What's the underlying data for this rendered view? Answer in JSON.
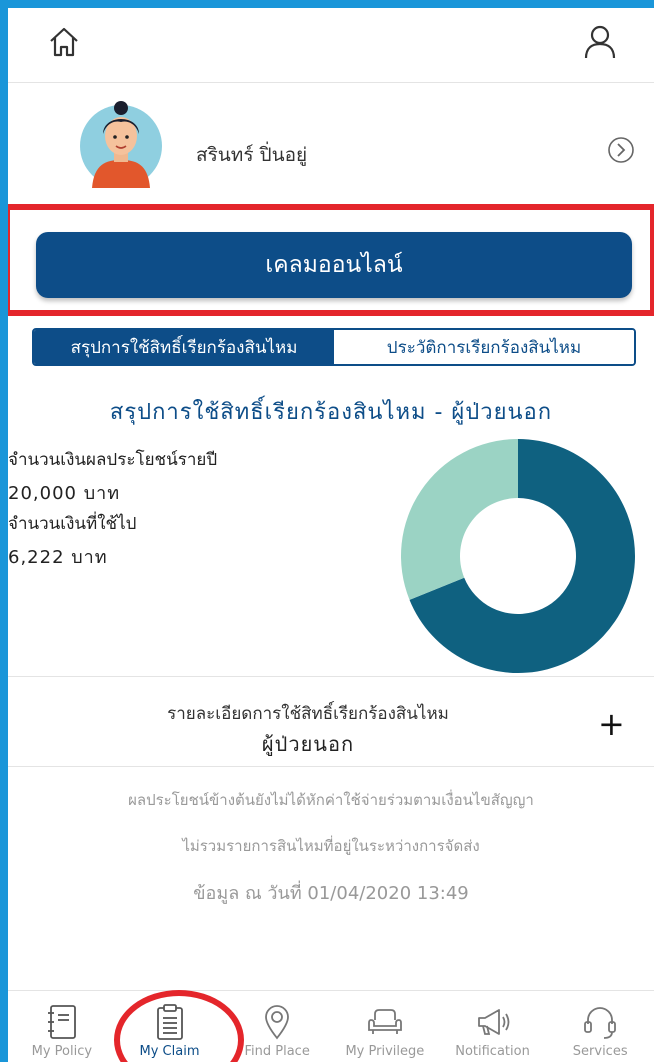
{
  "profile": {
    "name": "สรินทร์ ปิ่นอยู่"
  },
  "claim_button": {
    "label": "เคลมออนไลน์"
  },
  "tabs": [
    {
      "label": "สรุปการใช้สิทธิ์เรียกร้องสินไหม",
      "active": true
    },
    {
      "label": "ประวัติการเรียกร้องสินไหม",
      "active": false
    }
  ],
  "summary": {
    "title": "สรุปการใช้สิทธิ์เรียกร้องสินไหม - ผู้ป่วยนอก",
    "annual_label": "จำนวนเงินผลประโยชน์รายปี",
    "annual_value": "20,000 บาท",
    "used_label": "จำนวนเงินที่ใช้ไป",
    "used_value": "6,222 บาท"
  },
  "chart_data": {
    "type": "pie",
    "slices": [
      {
        "value": 6222,
        "color": "#9bd3c4"
      },
      {
        "value": 13778,
        "color": "#0f6180"
      }
    ]
  },
  "details": {
    "line1": "รายละเอียดการใช้สิทธิ์เรียกร้องสินไหม",
    "line2": "ผู้ป่วยนอก",
    "expand_symbol": "+"
  },
  "notes": {
    "note1": "ผลประโยชน์ข้างต้นยังไม่ได้หักค่าใช้จ่ายร่วมตามเงื่อนไขสัญญา",
    "note2": "ไม่รวมรายการสินไหมที่อยู่ในระหว่างการจัดส่ง",
    "note3": "ข้อมูล ณ วันที่ 01/04/2020 13:49"
  },
  "bottom_nav": [
    {
      "label": "My Policy",
      "icon": "policy-notebook-icon"
    },
    {
      "label": "My Claim",
      "icon": "clipboard-icon",
      "active": true
    },
    {
      "label": "Find Place",
      "icon": "map-pin-icon"
    },
    {
      "label": "My Privilege",
      "icon": "sofa-icon"
    },
    {
      "label": "Notification",
      "icon": "megaphone-icon"
    },
    {
      "label": "Services",
      "icon": "headset-icon"
    }
  ],
  "colors": {
    "primary": "#0d4d88",
    "frame": "#1a96d9",
    "highlight": "#e4262b",
    "donut_dark": "#0f6180",
    "donut_light": "#9bd3c4"
  }
}
